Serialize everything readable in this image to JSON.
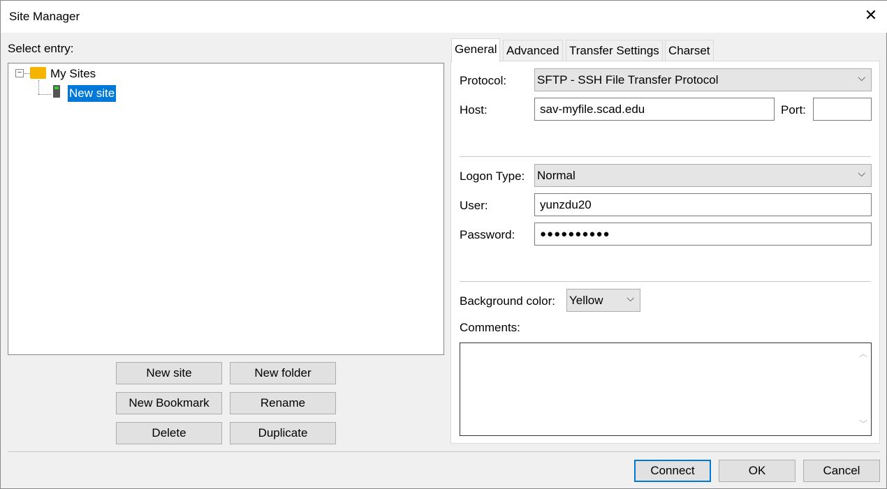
{
  "window": {
    "title": "Site Manager",
    "close_icon": "close-icon"
  },
  "left": {
    "label": "Select entry:",
    "tree": {
      "root": "My Sites",
      "child": "New site"
    }
  },
  "buttons": {
    "new_site": "New site",
    "new_folder": "New folder",
    "new_bookmark": "New Bookmark",
    "rename": "Rename",
    "delete": "Delete",
    "duplicate": "Duplicate"
  },
  "tabs": [
    "General",
    "Advanced",
    "Transfer Settings",
    "Charset"
  ],
  "general": {
    "protocol_label": "Protocol:",
    "protocol_value": "SFTP - SSH File Transfer Protocol",
    "host_label": "Host:",
    "host_value": "sav-myfile.scad.edu",
    "port_label": "Port:",
    "port_value": "",
    "logon_label": "Logon Type:",
    "logon_value": "Normal",
    "user_label": "User:",
    "user_value": "yunzdu20",
    "password_label": "Password:",
    "password_value": "●●●●●●●●●●",
    "bg_label": "Background color:",
    "bg_value": "Yellow",
    "comments_label": "Comments:",
    "comments_value": ""
  },
  "footer": {
    "connect": "Connect",
    "ok": "OK",
    "cancel": "Cancel"
  },
  "colors": {
    "selection": "#0078d7",
    "folder": "#f4b400"
  }
}
